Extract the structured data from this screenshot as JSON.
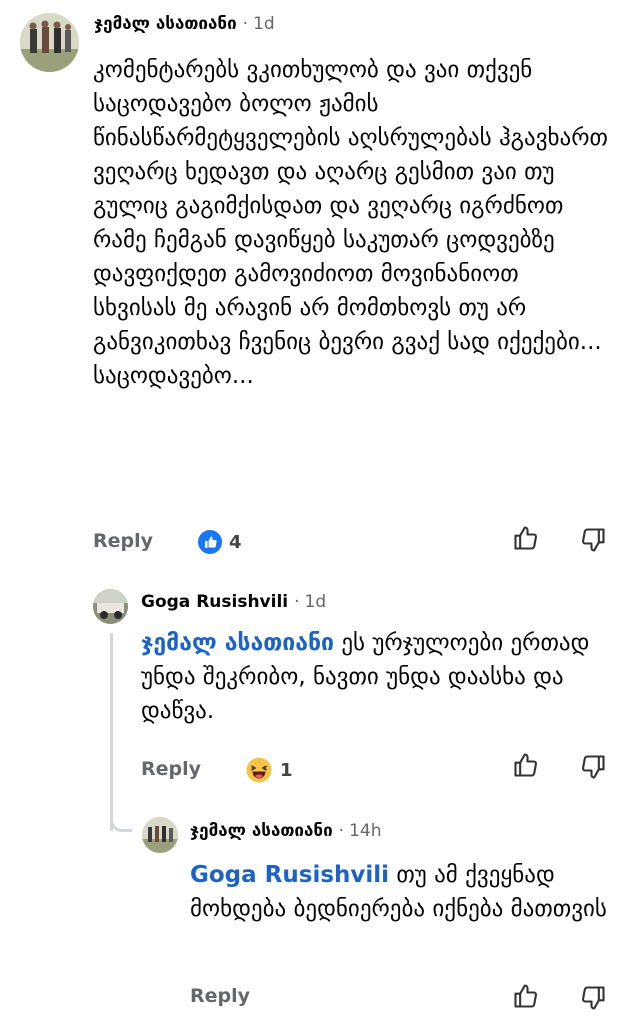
{
  "comments": [
    {
      "author": "ჯემალ ასათიანი",
      "time": "1d",
      "text": "კომენტარებს ვკითხულობ და ვაი თქვენ საცოდავებო ბოლო ჟამის წინასწარმეტყველების აღსრულებას ჰგავხართ ვეღარც ხედავთ და აღარც გესმით ვაი თუ გულიც გაგიმქისდათ და ვეღარც იგრძნოთ რამე ჩემგან დავიწყებ საკუთარ ცოდვებზე დავფიქდეთ გამოვიძიოთ მოვინანიოთ სხვისას მე არავინ არ მომთხოვს თუ არ განვიკითხავ ჩვენიც ბევრი გვაქ სად იქექები... საცოდავებო...",
      "reply_label": "Reply",
      "reaction_icon": "like-icon",
      "reaction_count": "4"
    },
    {
      "author": "Goga Rusishvili",
      "time": "1d",
      "mention": "ჯემალ ასათიანი",
      "text": "ეს ურჯულოები ერთად უნდა შეკრიბო, ნავთი უნდა დაასხა და დაწვა.",
      "reply_label": "Reply",
      "reaction_icon": "haha-emoji-icon",
      "reaction_count": "1"
    },
    {
      "author": "ჯემალ ასათიანი",
      "time": "14h",
      "mention": "Goga Rusishvili",
      "text": "თუ ამ ქვეყნად მოხდება ბედნიერება იქნება მათთვის",
      "reply_label": "Reply"
    }
  ],
  "meta_separator": "·",
  "colors": {
    "mention": "#1b62c9",
    "like": "#1877f2",
    "meta": "#65676b"
  }
}
